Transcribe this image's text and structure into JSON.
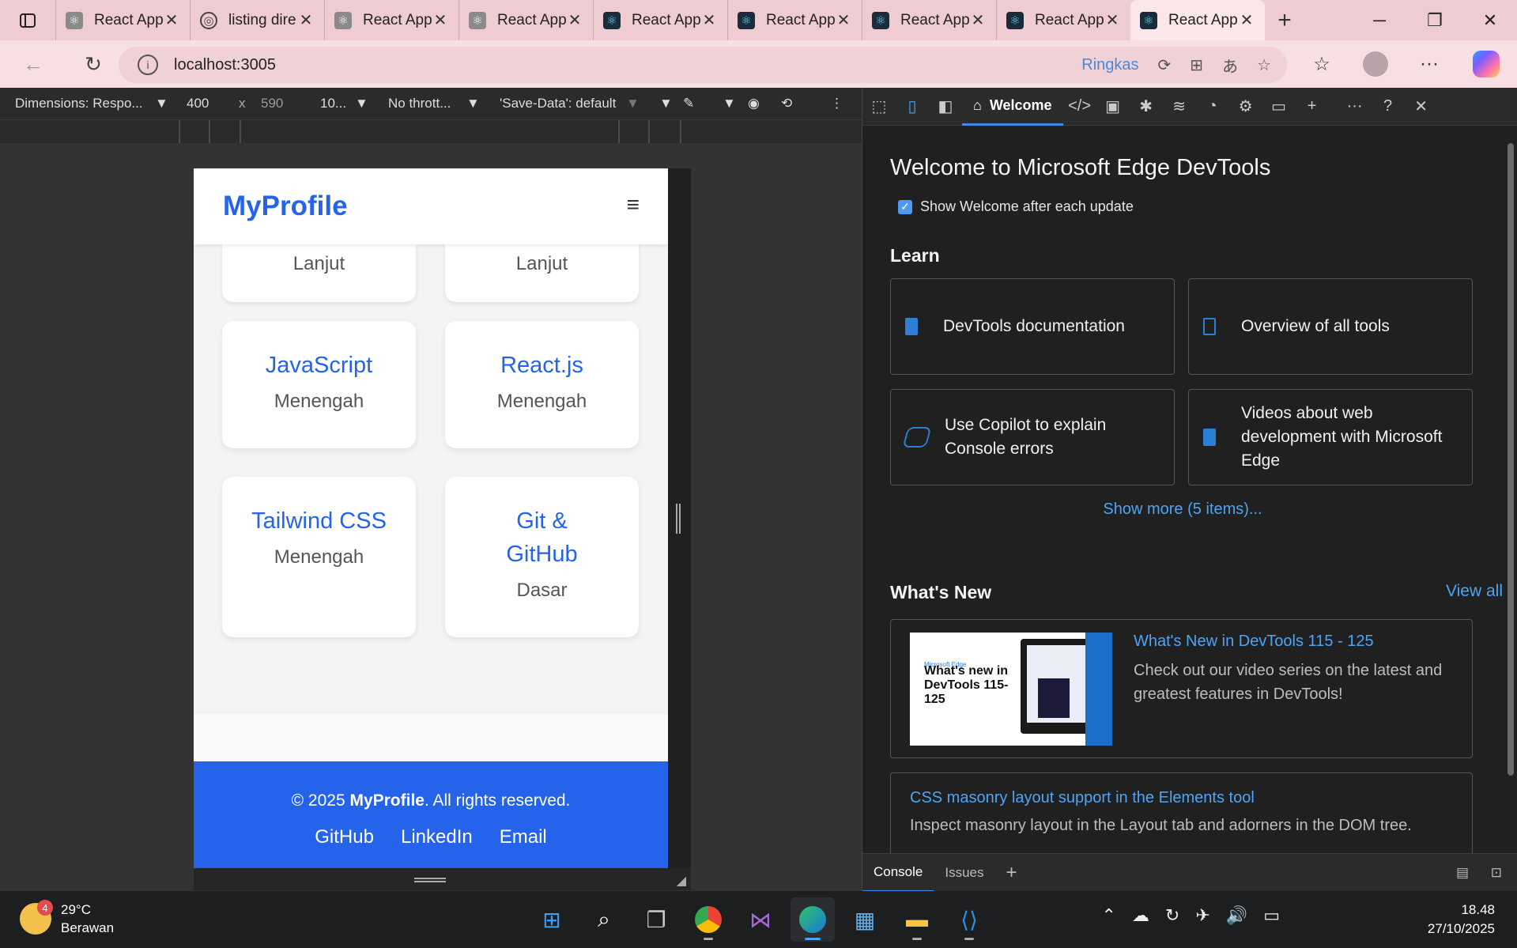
{
  "browser": {
    "tabs": [
      {
        "label": "React App",
        "icon": "react-gray"
      },
      {
        "label": "listing dire",
        "icon": "globe"
      },
      {
        "label": "React App",
        "icon": "react-gray"
      },
      {
        "label": "React App",
        "icon": "react-gray"
      },
      {
        "label": "React App",
        "icon": "react"
      },
      {
        "label": "React App",
        "icon": "react"
      },
      {
        "label": "React App",
        "icon": "react"
      },
      {
        "label": "React App",
        "icon": "react"
      },
      {
        "label": "React App",
        "icon": "react",
        "active": true
      }
    ],
    "url": "localhost:3005",
    "ringkas": "Ringkas"
  },
  "device_toolbar": {
    "dimensions": "Dimensions: Respo...",
    "width": "400",
    "times": "x",
    "height": "590",
    "zoom": "10...",
    "throttle": "No thrott...",
    "save_data": "'Save-Data': default"
  },
  "app": {
    "brand": "MyProfile",
    "menu_glyph": "≡",
    "skills": [
      {
        "name": "",
        "level": "Lanjut"
      },
      {
        "name": "",
        "level": "Lanjut"
      },
      {
        "name": "JavaScript",
        "level": "Menengah"
      },
      {
        "name": "React.js",
        "level": "Menengah"
      },
      {
        "name": "Tailwind CSS",
        "level": "Menengah"
      },
      {
        "name": "Git & GitHub",
        "level": "Dasar"
      }
    ],
    "footer": {
      "copy_prefix": "© 2025 ",
      "copy_brand": "MyProfile",
      "copy_suffix": ". All rights reserved.",
      "links": [
        "GitHub",
        "LinkedIn",
        "Email"
      ]
    }
  },
  "devtools": {
    "tab_welcome": "Welcome",
    "title": "Welcome to Microsoft Edge DevTools",
    "show_welcome": "Show Welcome after each update",
    "learn_heading": "Learn",
    "learn_cards": [
      "DevTools documentation",
      "Overview of all tools",
      "Use Copilot to explain Console errors",
      "Videos about web development with Microsoft Edge"
    ],
    "show_more": "Show more (5 items)...",
    "whats_new_heading": "What's New",
    "view_all": "View all",
    "news": [
      {
        "title": "What's New in DevTools 115 - 125",
        "desc": "Check out our video series on the latest and greatest features in DevTools!",
        "thumb_small": "Microsoft Edge",
        "thumb_text": "What's new in DevTools 115-125"
      },
      {
        "title": "CSS masonry layout support in the Elements tool",
        "desc": "Inspect masonry layout in the Layout tab and adorners in the DOM tree."
      }
    ],
    "drawer_tabs": [
      "Console",
      "Issues"
    ]
  },
  "taskbar": {
    "weather_temp": "29°C",
    "weather_desc": "Berawan",
    "weather_badge": "4",
    "time": "18.48",
    "date": "27/10/2025"
  }
}
